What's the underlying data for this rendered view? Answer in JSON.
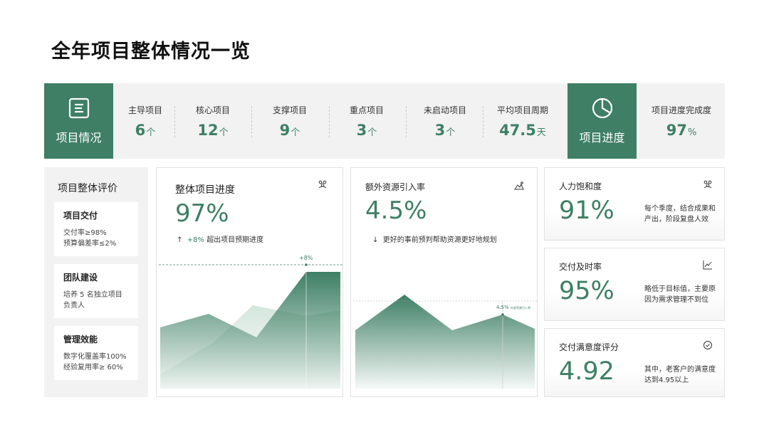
{
  "page_title": "全年项目整体情况一览",
  "overview": {
    "label": "项目情况",
    "icon": "document-icon",
    "stats": [
      {
        "label": "主导项目",
        "value": "6",
        "unit": "个"
      },
      {
        "label": "核心项目",
        "value": "12",
        "unit": "个"
      },
      {
        "label": "支撑项目",
        "value": "9",
        "unit": "个"
      },
      {
        "label": "重点项目",
        "value": "3",
        "unit": "个"
      },
      {
        "label": "未启动项目",
        "value": "3",
        "unit": "个"
      },
      {
        "label": "平均项目周期",
        "value": "47.5",
        "unit": "天"
      }
    ]
  },
  "progress": {
    "label": "项目进度",
    "icon": "pie-clock-icon",
    "stat": {
      "label": "项目进度完成度",
      "value": "97",
      "unit": "%"
    }
  },
  "evaluation": {
    "title": "项目整体评价",
    "cards": [
      {
        "title": "项目交付",
        "lines": [
          "交付率≥98%",
          "预算偏差率≤2%"
        ]
      },
      {
        "title": "团队建设",
        "lines": [
          "培养 5 名独立项目",
          "负责人"
        ]
      },
      {
        "title": "管理效能",
        "lines": [
          "数字化覆盖率100%",
          "经验复用率≥ 60%"
        ]
      }
    ]
  },
  "card_progress": {
    "title": "整体项目进度",
    "big": "97%",
    "note_arrow": "↑",
    "note_delta": "+8%",
    "note_text": "超出项目预期进度",
    "marker_label": "+8%",
    "icon": "team-icon"
  },
  "card_resource": {
    "title": "额外资源引入率",
    "big": "4.5%",
    "note_arrow": "↓",
    "note_text": "更好的事前预判帮助资源更好地规划",
    "marker_label": "4.5%",
    "marker_sub": "外部资源引入率",
    "icon": "mountain-chart-icon"
  },
  "metrics": [
    {
      "title": "人力饱和度",
      "big": "91%",
      "desc": "每个季度，结合成果和产出，阶段复盘人效",
      "icon": "team-icon"
    },
    {
      "title": "交付及时率",
      "big": "95%",
      "desc": "略低于目标值，主要原因为需求管理不到位",
      "icon": "line-chart-icon"
    },
    {
      "title": "交付满意度评分",
      "big": "4.92",
      "desc": "其中，老客户的满意度达到4.95以上",
      "icon": "check-circle-icon"
    }
  ],
  "colors": {
    "accent": "#3e7f65",
    "panel": "#f2f2f2"
  }
}
